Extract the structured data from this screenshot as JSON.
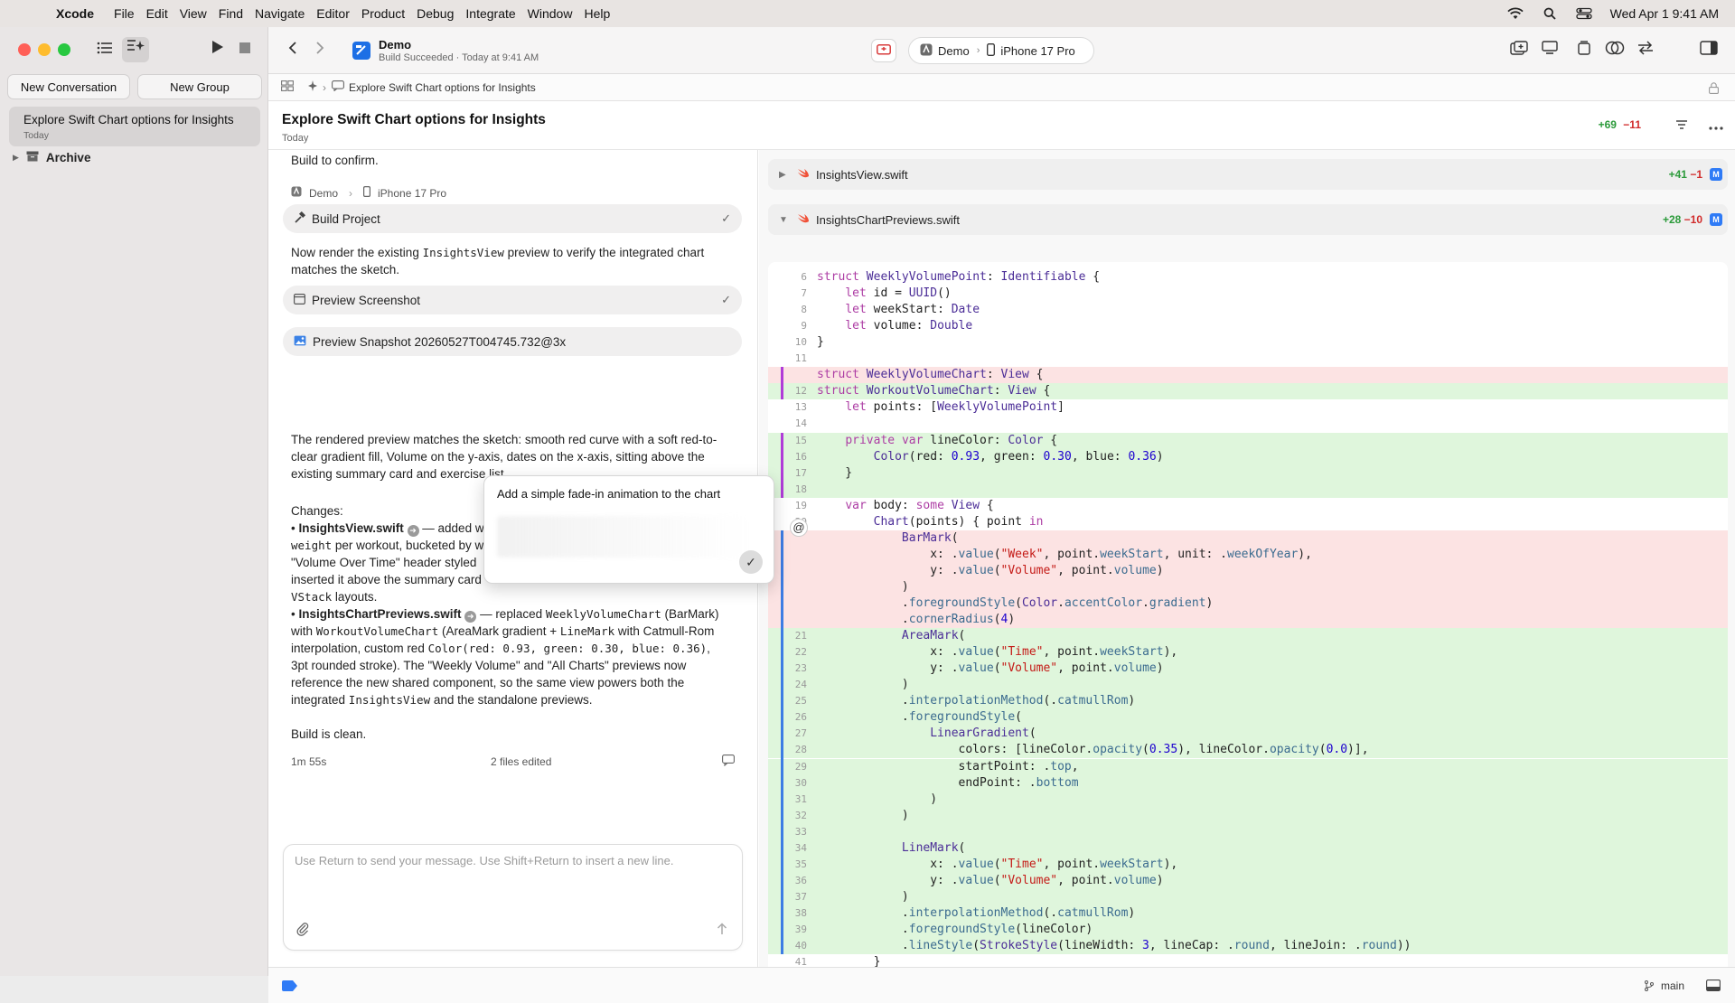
{
  "menubar": {
    "app": "Xcode",
    "menus": [
      "File",
      "Edit",
      "View",
      "Find",
      "Navigate",
      "Editor",
      "Product",
      "Debug",
      "Integrate",
      "Window",
      "Help"
    ],
    "clock": "Wed Apr 1  9:41 AM"
  },
  "toolbar": {
    "project": "Demo",
    "status": "Build Succeeded · Today at 9:41 AM",
    "scheme": "Demo",
    "device": "iPhone 17 Pro"
  },
  "sidebar": {
    "new_conversation": "New Conversation",
    "new_group": "New Group",
    "conversation_title": "Explore Swift Chart options for Insights",
    "conversation_date": "Today",
    "archive": "Archive"
  },
  "tabbar": {
    "label": "Explore Swift Chart options for Insights"
  },
  "header": {
    "title": "Explore Swift Chart options for Insights",
    "date": "Today",
    "plus": "+69",
    "minus": "−11"
  },
  "conversation": {
    "build_confirm": "Build to confirm.",
    "target_scheme": "Demo",
    "target_device": "iPhone 17 Pro",
    "tool1": "Build Project",
    "para1_a": "Now render the existing ",
    "para1_code": "InsightsView",
    "para1_b": " preview to verify the integrated chart matches the sketch.",
    "tool2": "Preview Screenshot",
    "tool3": "Preview Snapshot 20260527T004745.732@3x",
    "para2": "The rendered preview matches the sketch: smooth red curve with a soft red-to-clear gradient fill, Volume on the y-axis, dates on the x-axis, sitting above the existing summary card and exercise list.",
    "changes_label": "Changes:",
    "c1_file": "InsightsView.swift",
    "c1_a": " — added w",
    "c1_line2_code": "weight",
    "c1_line2": " per workout, bucketed by w",
    "c1_line3": "\"Volume Over Time\" header styled",
    "c1_line4": "inserted it above the summary card",
    "c1_line5_code": "VStack",
    "c1_line5": " layouts.",
    "c2_file": "InsightsChartPreviews.swift",
    "c2_a": " — replaced ",
    "c2_code1": "WeeklyVolumeChart",
    "c2_b": " (BarMark)",
    "c2_line2_a": "with ",
    "c2_line2_code": "WorkoutVolumeChart",
    "c2_line2_b": " (AreaMark gradient + ",
    "c2_line2_code2": "LineMark",
    "c2_line2_c": " with Catmull-Rom",
    "c2_line3_a": "interpolation, custom red ",
    "c2_line3_code": "Color(red: 0.93, green: 0.30, blue: 0.36)",
    "c2_line3_b": ",",
    "c2_line4": "3pt rounded stroke). The \"Weekly Volume\" and \"All Charts\" previews now",
    "c2_line5": "reference the new shared component, so the same view powers both the",
    "c2_line6_a": "integrated ",
    "c2_line6_code": "InsightsView",
    "c2_line6_b": " and the standalone previews.",
    "build_clean": "Build is clean.",
    "duration": "1m 55s",
    "files_edited": "2 files edited"
  },
  "composer": {
    "placeholder": "Use Return to send your message. Use Shift+Return to insert a new line."
  },
  "popup": {
    "text": "Add a simple fade-in animation to the chart"
  },
  "diff": {
    "file1": {
      "name": "InsightsView.swift",
      "plus": "+41",
      "minus": "−1",
      "badge": "M"
    },
    "file2": {
      "name": "InsightsChartPreviews.swift",
      "plus": "+28",
      "minus": "−10",
      "badge": "M"
    },
    "lines": [
      {
        "n": "6",
        "t": "ctx",
        "c": "struct WeeklyVolumePoint: Identifiable {"
      },
      {
        "n": "7",
        "t": "ctx",
        "c": "    let id = UUID()"
      },
      {
        "n": "8",
        "t": "ctx",
        "c": "    let weekStart: Date"
      },
      {
        "n": "9",
        "t": "ctx",
        "c": "    let volume: Double"
      },
      {
        "n": "10",
        "t": "ctx",
        "c": "}"
      },
      {
        "n": "11",
        "t": "ctx",
        "c": ""
      },
      {
        "n": "",
        "t": "del",
        "c": "struct WeeklyVolumeChart: View {"
      },
      {
        "n": "12",
        "t": "add",
        "c": "struct WorkoutVolumeChart: View {"
      },
      {
        "n": "13",
        "t": "ctx",
        "c": "    let points: [WeeklyVolumePoint]"
      },
      {
        "n": "14",
        "t": "ctx",
        "c": ""
      },
      {
        "n": "15",
        "t": "add",
        "c": "    private var lineColor: Color {"
      },
      {
        "n": "16",
        "t": "add",
        "c": "        Color(red: 0.93, green: 0.30, blue: 0.36)"
      },
      {
        "n": "17",
        "t": "add",
        "c": "    }"
      },
      {
        "n": "18",
        "t": "add",
        "c": ""
      },
      {
        "n": "19",
        "t": "ctx",
        "c": "    var body: some View {"
      },
      {
        "n": "20",
        "t": "ctx",
        "c": "        Chart(points) { point in"
      },
      {
        "n": "",
        "t": "del",
        "c": "            BarMark("
      },
      {
        "n": "",
        "t": "del",
        "c": "                x: .value(\"Week\", point.weekStart, unit: .weekOfYear),"
      },
      {
        "n": "",
        "t": "del",
        "c": "                y: .value(\"Volume\", point.volume)"
      },
      {
        "n": "",
        "t": "del",
        "c": "            )"
      },
      {
        "n": "",
        "t": "del",
        "c": "            .foregroundStyle(Color.accentColor.gradient)"
      },
      {
        "n": "",
        "t": "del",
        "c": "            .cornerRadius(4)"
      },
      {
        "n": "21",
        "t": "add",
        "c": "            AreaMark("
      },
      {
        "n": "22",
        "t": "add",
        "c": "                x: .value(\"Time\", point.weekStart),"
      },
      {
        "n": "23",
        "t": "add",
        "c": "                y: .value(\"Volume\", point.volume)"
      },
      {
        "n": "24",
        "t": "add",
        "c": "            )"
      },
      {
        "n": "25",
        "t": "add",
        "c": "            .interpolationMethod(.catmullRom)"
      },
      {
        "n": "26",
        "t": "add",
        "c": "            .foregroundStyle("
      },
      {
        "n": "27",
        "t": "add",
        "c": "                LinearGradient("
      },
      {
        "n": "28",
        "t": "add",
        "c": "                    colors: [lineColor.opacity(0.35), lineColor.opacity(0.0)],"
      },
      {
        "n": "29",
        "t": "add",
        "c": "                    startPoint: .top,"
      },
      {
        "n": "30",
        "t": "add",
        "c": "                    endPoint: .bottom"
      },
      {
        "n": "31",
        "t": "add",
        "c": "                )"
      },
      {
        "n": "32",
        "t": "add",
        "c": "            )"
      },
      {
        "n": "33",
        "t": "add",
        "c": ""
      },
      {
        "n": "34",
        "t": "add",
        "c": "            LineMark("
      },
      {
        "n": "35",
        "t": "add",
        "c": "                x: .value(\"Time\", point.weekStart),"
      },
      {
        "n": "36",
        "t": "add",
        "c": "                y: .value(\"Volume\", point.volume)"
      },
      {
        "n": "37",
        "t": "add",
        "c": "            )"
      },
      {
        "n": "38",
        "t": "add",
        "c": "            .interpolationMethod(.catmullRom)"
      },
      {
        "n": "39",
        "t": "add",
        "c": "            .foregroundStyle(lineColor)"
      },
      {
        "n": "40",
        "t": "add",
        "c": "            .lineStyle(StrokeStyle(lineWidth: 3, lineCap: .round, lineJoin: .round))"
      },
      {
        "n": "41",
        "t": "ctx",
        "c": "        }"
      }
    ]
  },
  "statusbar": {
    "branch": "main"
  },
  "colors": {
    "accent": "#2f7bf6",
    "added": "#dff6dc",
    "removed": "#fce3e3",
    "swift": "#f05138"
  }
}
